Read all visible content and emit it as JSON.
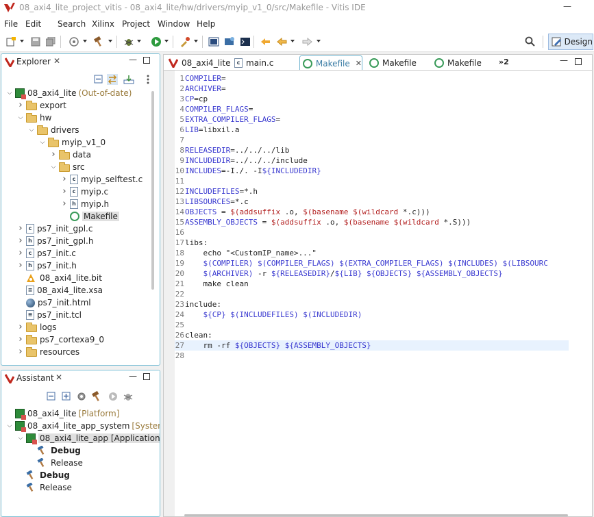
{
  "window": {
    "title": "08_axi4_lite_project_vitis - 08_axi4_lite/hw/drivers/myip_v1_0/src/Makefile - Vitis IDE",
    "minimize_glyph": "—"
  },
  "menu": [
    "File",
    "Edit",
    "Search",
    "Xilinx",
    "Project",
    "Window",
    "Help"
  ],
  "toolbar": {
    "design_label": "Design"
  },
  "explorer": {
    "title": "Explorer",
    "tree": [
      {
        "label": "08_axi4_lite",
        "suffix": "(Out-of-date)",
        "icon": "project-icon",
        "depth": 0,
        "twisty": "open"
      },
      {
        "label": "export",
        "icon": "folder-icon",
        "depth": 1,
        "twisty": "closed"
      },
      {
        "label": "hw",
        "icon": "folder-icon",
        "depth": 1,
        "twisty": "open"
      },
      {
        "label": "drivers",
        "icon": "folder-icon",
        "depth": 2,
        "twisty": "open"
      },
      {
        "label": "myip_v1_0",
        "icon": "folder-icon",
        "depth": 3,
        "twisty": "open"
      },
      {
        "label": "data",
        "icon": "folder-icon",
        "depth": 4,
        "twisty": "closed"
      },
      {
        "label": "src",
        "icon": "folder-icon",
        "depth": 4,
        "twisty": "open"
      },
      {
        "label": "myip_selftest.c",
        "icon": "c-file-icon",
        "depth": 5,
        "twisty": "closed"
      },
      {
        "label": "myip.c",
        "icon": "c-file-icon",
        "depth": 5,
        "twisty": "closed"
      },
      {
        "label": "myip.h",
        "icon": "h-file-icon",
        "depth": 5,
        "twisty": "closed"
      },
      {
        "label": "Makefile",
        "icon": "makefile-icon",
        "depth": 5,
        "twisty": "none",
        "selected": true
      },
      {
        "label": "ps7_init_gpl.c",
        "icon": "c-file-icon",
        "depth": 1,
        "twisty": "closed"
      },
      {
        "label": "ps7_init_gpl.h",
        "icon": "h-file-icon",
        "depth": 1,
        "twisty": "closed"
      },
      {
        "label": "ps7_init.c",
        "icon": "c-file-icon",
        "depth": 1,
        "twisty": "closed"
      },
      {
        "label": "ps7_init.h",
        "icon": "h-file-icon",
        "depth": 1,
        "twisty": "closed"
      },
      {
        "label": "08_axi4_lite.bit",
        "icon": "bitstream-icon",
        "depth": 1,
        "twisty": "none"
      },
      {
        "label": "08_axi4_lite.xsa",
        "icon": "xsa-file-icon",
        "depth": 1,
        "twisty": "none"
      },
      {
        "label": "ps7_init.html",
        "icon": "html-file-icon",
        "depth": 1,
        "twisty": "none"
      },
      {
        "label": "ps7_init.tcl",
        "icon": "tcl-file-icon",
        "depth": 1,
        "twisty": "none"
      },
      {
        "label": "logs",
        "icon": "folder-icon",
        "depth": 1,
        "twisty": "closed"
      },
      {
        "label": "ps7_cortexa9_0",
        "icon": "folder-icon",
        "depth": 1,
        "twisty": "closed"
      },
      {
        "label": "resources",
        "icon": "folder-icon",
        "depth": 1,
        "twisty": "closed"
      }
    ]
  },
  "assistant": {
    "title": "Assistant",
    "tree": [
      {
        "label": "08_axi4_lite",
        "suffix": "[Platform]",
        "icon": "platform-icon",
        "depth": 0,
        "twisty": "none"
      },
      {
        "label": "08_axi4_lite_app_system",
        "suffix": "[System]",
        "icon": "system-icon",
        "depth": 0,
        "twisty": "open"
      },
      {
        "label": "08_axi4_lite_app [Application]",
        "icon": "application-icon",
        "depth": 1,
        "twisty": "open",
        "selected": true
      },
      {
        "label": "Debug",
        "icon": "hammer-icon",
        "depth": 2,
        "twisty": "none",
        "bold": true
      },
      {
        "label": "Release",
        "icon": "hammer-icon",
        "depth": 2,
        "twisty": "none"
      },
      {
        "label": "Debug",
        "icon": "hammer-icon",
        "depth": 1,
        "twisty": "none",
        "bold": true
      },
      {
        "label": "Release",
        "icon": "hammer-icon",
        "depth": 1,
        "twisty": "none"
      }
    ]
  },
  "editor": {
    "tabs": [
      {
        "label": "08_axi4_lite",
        "icon": "vitis-icon"
      },
      {
        "label": "main.c",
        "icon": "c-file-icon"
      },
      {
        "label": "Makefile",
        "icon": "makefile-icon",
        "active": true
      },
      {
        "label": "Makefile",
        "icon": "makefile-icon"
      },
      {
        "label": "Makefile",
        "icon": "makefile-icon"
      }
    ],
    "overflow_label": "»2",
    "current_line": 27,
    "lines": [
      [
        [
          "v",
          "COMPILER"
        ],
        [
          "t",
          "="
        ]
      ],
      [
        [
          "v",
          "ARCHIVER"
        ],
        [
          "t",
          "="
        ]
      ],
      [
        [
          "v",
          "CP"
        ],
        [
          "t",
          "=cp"
        ]
      ],
      [
        [
          "v",
          "COMPILER_FLAGS"
        ],
        [
          "t",
          "="
        ]
      ],
      [
        [
          "v",
          "EXTRA_COMPILER_FLAGS"
        ],
        [
          "t",
          "="
        ]
      ],
      [
        [
          "v",
          "LIB"
        ],
        [
          "t",
          "=libxil.a"
        ]
      ],
      [],
      [
        [
          "v",
          "RELEASEDIR"
        ],
        [
          "t",
          "=../../../lib"
        ]
      ],
      [
        [
          "v",
          "INCLUDEDIR"
        ],
        [
          "t",
          "=../../../include"
        ]
      ],
      [
        [
          "v",
          "INCLUDES"
        ],
        [
          "t",
          "=-I./. -I"
        ],
        [
          "v",
          "${INCLUDEDIR}"
        ]
      ],
      [],
      [
        [
          "v",
          "INCLUDEFILES"
        ],
        [
          "t",
          "=*.h"
        ]
      ],
      [
        [
          "v",
          "LIBSOURCES"
        ],
        [
          "t",
          "=*.c"
        ]
      ],
      [
        [
          "v",
          "OBJECTS"
        ],
        [
          "t",
          " = "
        ],
        [
          "f",
          "$(addsuffix"
        ],
        [
          "t",
          " .o, "
        ],
        [
          "f",
          "$(basename"
        ],
        [
          "t",
          " "
        ],
        [
          "f",
          "$(wildcard"
        ],
        [
          "t",
          " *.c)))"
        ]
      ],
      [
        [
          "v",
          "ASSEMBLY_OBJECTS"
        ],
        [
          "t",
          " = "
        ],
        [
          "f",
          "$(addsuffix"
        ],
        [
          "t",
          " .o, "
        ],
        [
          "f",
          "$(basename"
        ],
        [
          "t",
          " "
        ],
        [
          "f",
          "$(wildcard"
        ],
        [
          "t",
          " *.S)))"
        ]
      ],
      [],
      [
        [
          "t",
          "libs:"
        ]
      ],
      [
        [
          "t",
          "    echo \"<CustomIP_name>...\""
        ]
      ],
      [
        [
          "t",
          "    "
        ],
        [
          "v",
          "$(COMPILER)"
        ],
        [
          "t",
          " "
        ],
        [
          "v",
          "$(COMPILER_FLAGS)"
        ],
        [
          "t",
          " "
        ],
        [
          "v",
          "$(EXTRA_COMPILER_FLAGS)"
        ],
        [
          "t",
          " "
        ],
        [
          "v",
          "$(INCLUDES)"
        ],
        [
          "t",
          " "
        ],
        [
          "v",
          "$(LIBSOURC"
        ]
      ],
      [
        [
          "t",
          "    "
        ],
        [
          "v",
          "$(ARCHIVER)"
        ],
        [
          "t",
          " -r "
        ],
        [
          "v",
          "${RELEASEDIR}"
        ],
        [
          "t",
          "/"
        ],
        [
          "v",
          "${LIB}"
        ],
        [
          "t",
          " "
        ],
        [
          "v",
          "${OBJECTS}"
        ],
        [
          "t",
          " "
        ],
        [
          "v",
          "${ASSEMBLY_OBJECTS}"
        ]
      ],
      [
        [
          "t",
          "    make clean"
        ]
      ],
      [],
      [
        [
          "t",
          "include:"
        ]
      ],
      [
        [
          "t",
          "    "
        ],
        [
          "v",
          "${CP}"
        ],
        [
          "t",
          " "
        ],
        [
          "v",
          "$(INCLUDEFILES)"
        ],
        [
          "t",
          " "
        ],
        [
          "v",
          "$(INCLUDEDIR)"
        ]
      ],
      [],
      [
        [
          "t",
          "clean:"
        ]
      ],
      [
        [
          "t",
          "    rm -rf "
        ],
        [
          "v",
          "${OBJECTS}"
        ],
        [
          "t",
          " "
        ],
        [
          "v",
          "${ASSEMBLY_OBJECTS}"
        ]
      ],
      []
    ]
  },
  "colors": {
    "accent": "#7cc0d6",
    "variable": "#3a3ad0",
    "function": "#b22020"
  }
}
